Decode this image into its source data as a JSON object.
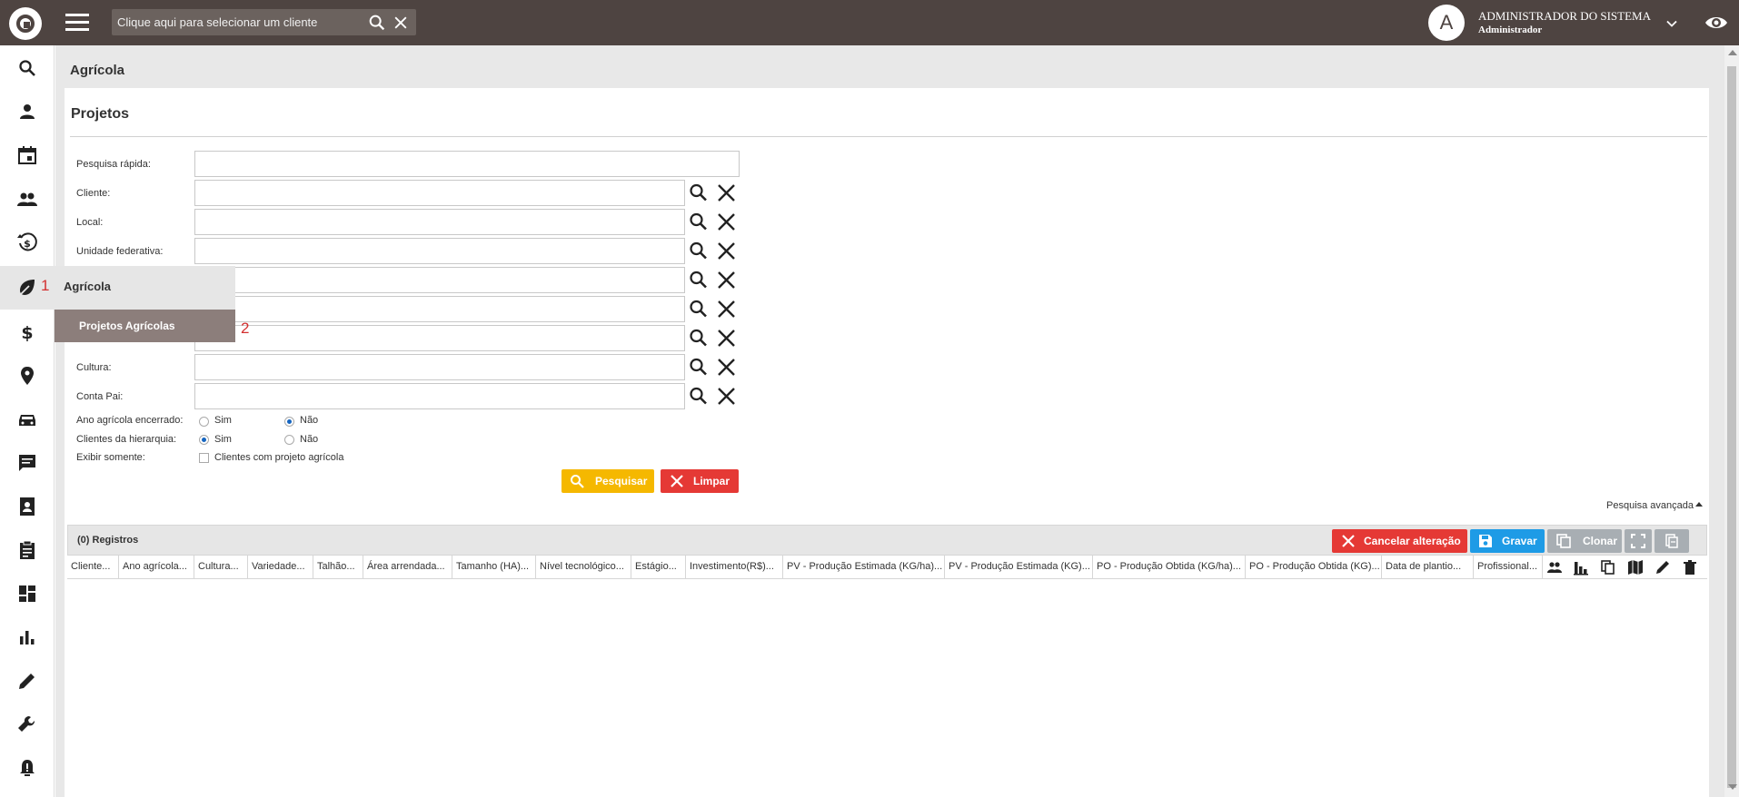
{
  "topbar": {
    "client_search_placeholder": "Clique aqui para selecionar um cliente",
    "avatar_letter": "A",
    "user_name": "ADMINISTRADOR DO SISTEMA",
    "user_role": "Administrador"
  },
  "sidebar": {
    "items": [
      "search-icon",
      "person-icon",
      "calendar-icon",
      "people-icon",
      "history-dollar-icon",
      "leaf-icon",
      "dollar-icon",
      "location-pin-icon",
      "car-icon",
      "chat-icon",
      "contact-book-icon",
      "clipboard-icon",
      "dashboard-icon",
      "bar-chart-icon",
      "pencil-icon",
      "wrench-icon",
      "alarm-icon"
    ]
  },
  "flyout": {
    "number": "1",
    "label": "Agrícola",
    "submenu_label": "Projetos Agrícolas",
    "submenu_number": "2"
  },
  "page": {
    "breadcrumb": "Agrícola",
    "title": "Projetos"
  },
  "form": {
    "quick_search_label": "Pesquisa rápida:",
    "cliente_label": "Cliente:",
    "local_label": "Local:",
    "uf_label": "Unidade federativa:",
    "cultura_label": "Cultura:",
    "conta_pai_label": "Conta Pai:",
    "ano_encerrado_label": "Ano agrícola encerrado:",
    "hierarquia_label": "Clientes da hierarquia:",
    "exibir_label": "Exibir somente:",
    "sim": "Sim",
    "nao": "Não",
    "ano_encerrado_value": "Não",
    "hierarquia_value": "Sim",
    "checkbox_label": "Clientes com projeto agrícola",
    "pesquisar_label": "Pesquisar",
    "limpar_label": "Limpar",
    "advanced_search": "Pesquisa avançada"
  },
  "grid": {
    "count": "(0) Registros",
    "cancel_label": "Cancelar alteração",
    "save_label": "Gravar",
    "clone_label": "Clonar",
    "columns": [
      "Cliente...",
      "Ano agrícola...",
      "Cultura...",
      "Variedade...",
      "Talhão...",
      "Área arrendada...",
      "Tamanho (HA)...",
      "Nível tecnológico...",
      "Estágio...",
      "Investimento(R$)...",
      "PV - Produção Estimada (KG/ha)...",
      "PV - Produção Estimada (KG)...",
      "PO - Produção Obtida (KG/ha)...",
      "PO - Produção Obtida (KG)...",
      "Data de plantio...",
      "Profissional..."
    ],
    "action_icons": [
      "people-icon",
      "bar-chart-icon",
      "copy-icon",
      "map-icon",
      "edit-icon",
      "trash-icon"
    ]
  },
  "colors": {
    "topbar": "#4e4441",
    "yellow": "#f5b800",
    "red": "#e53935",
    "blue": "#1e9be6",
    "grey": "#a8aeb3",
    "annotation": "#d32f2f"
  }
}
